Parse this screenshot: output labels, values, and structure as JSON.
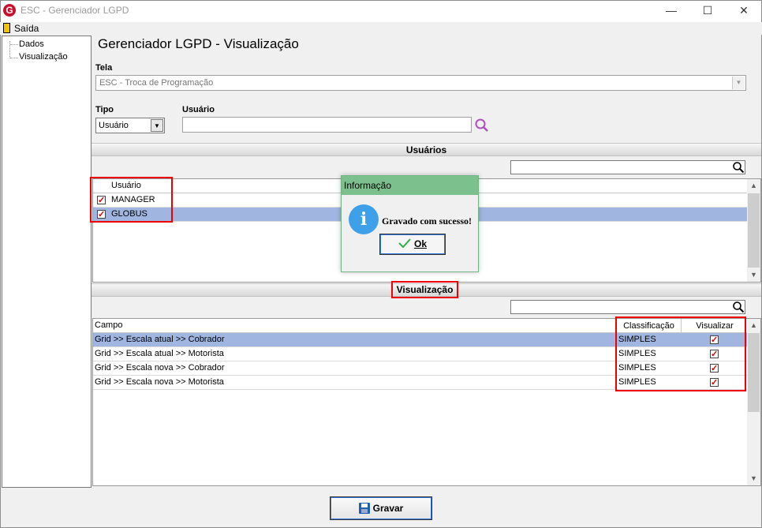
{
  "window": {
    "title": "ESC - Gerenciador LGPD",
    "logo_letter": "G"
  },
  "menu": {
    "exit_label": "Saída"
  },
  "tree": {
    "items": [
      {
        "label": "Dados"
      },
      {
        "label": "Visualização"
      }
    ]
  },
  "main": {
    "title": "Gerenciador LGPD - Visualização",
    "tela_label": "Tela",
    "tela_value": "ESC - Troca de Programação",
    "tipo_label": "Tipo",
    "tipo_value": "Usuário",
    "usuario_label": "Usuário",
    "usuario_value": ""
  },
  "usuarios_section": {
    "title": "Usuários",
    "filter_value": "",
    "column_header": "Usuário",
    "rows": [
      {
        "name": "MANAGER",
        "checked": true,
        "selected": false
      },
      {
        "name": "GLOBUS",
        "checked": true,
        "selected": true
      }
    ]
  },
  "visualizacao_section": {
    "title": "Visualização",
    "filter_value": "",
    "headers": {
      "campo": "Campo",
      "classificacao": "Classificação",
      "visualizar": "Visualizar"
    },
    "rows": [
      {
        "campo": "Grid >> Escala atual >> Cobrador",
        "classificacao": "SIMPLES",
        "visualizar": true,
        "selected": true
      },
      {
        "campo": "Grid >> Escala atual >> Motorista",
        "classificacao": "SIMPLES",
        "visualizar": true,
        "selected": false
      },
      {
        "campo": "Grid >> Escala nova >> Cobrador",
        "classificacao": "SIMPLES",
        "visualizar": true,
        "selected": false
      },
      {
        "campo": "Grid >> Escala nova >> Motorista",
        "classificacao": "SIMPLES",
        "visualizar": true,
        "selected": false
      }
    ]
  },
  "dialog": {
    "title": "Informação",
    "message": "Gravado com sucesso!",
    "ok_label": "Ok",
    "icon": "info-icon"
  },
  "footer": {
    "gravar_label": "Gravar"
  },
  "colors": {
    "dialog_header": "#7cc08e",
    "selection": "#a0b6e0",
    "highlight": "#e00000",
    "info": "#3fa0ea"
  }
}
